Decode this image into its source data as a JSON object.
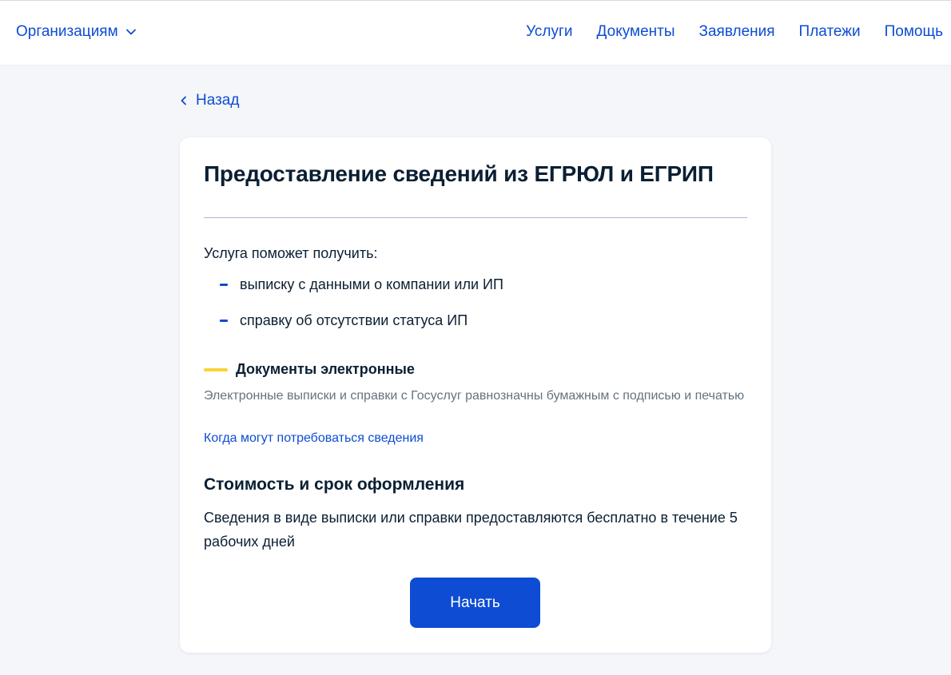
{
  "header": {
    "org_menu_label": "Организациям",
    "nav": [
      "Услуги",
      "Документы",
      "Заявления",
      "Платежи",
      "Помощь"
    ]
  },
  "back_label": "Назад",
  "card": {
    "title": "Предоставление сведений из ЕГРЮЛ и ЕГРИП",
    "intro": "Услуга поможет получить:",
    "bullets": [
      "выписку с данными о компании или ИП",
      "справку об отсутствии статуса ИП"
    ],
    "documents": {
      "heading": "Документы электронные",
      "description": "Электронные выписки и справки с Госуслуг равнозначны бумажным с подписью и печатью",
      "link": "Когда могут потребоваться сведения"
    },
    "cost": {
      "heading": "Стоимость и срок оформления",
      "text": "Сведения в виде выписки или справки предоставляются бесплатно в течение 5 рабочих дней"
    },
    "start_button": "Начать"
  },
  "colors": {
    "accent": "#0d4cd3",
    "highlight": "#fbd438",
    "text": "#0b1f33",
    "muted": "#66727f",
    "background": "#f5f6fa"
  },
  "icons": {
    "org_menu": "chevron-down-icon",
    "back": "chevron-left-icon"
  }
}
